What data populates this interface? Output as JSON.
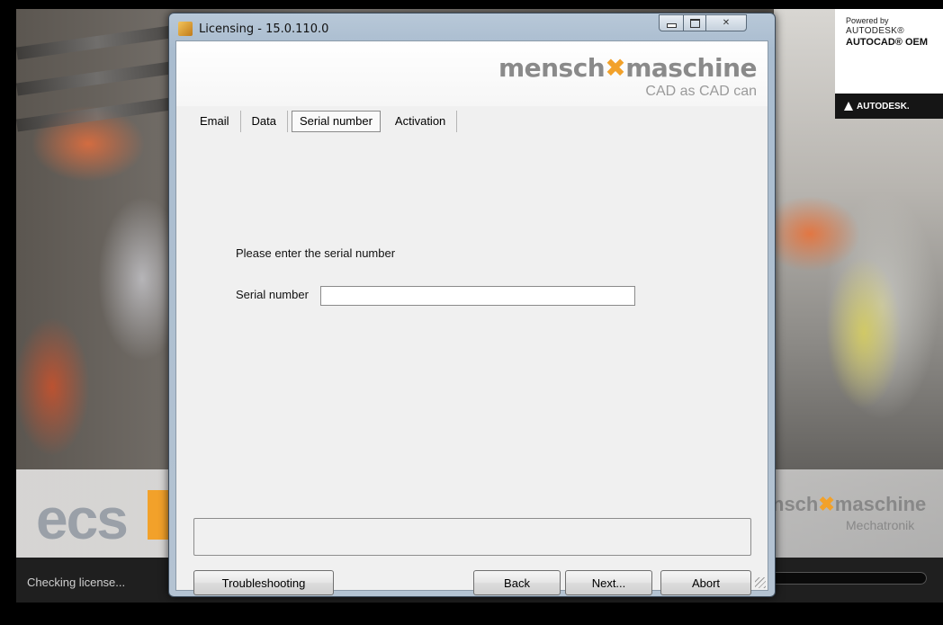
{
  "window": {
    "title": "Licensing - 15.0.110.0"
  },
  "header": {
    "logo_left": "mensch",
    "logo_mark": "✖",
    "logo_right": "maschine",
    "tagline": "CAD as CAD can"
  },
  "tabs": [
    {
      "label": "Email",
      "active": false
    },
    {
      "label": "Data",
      "active": false
    },
    {
      "label": "Serial number",
      "active": true
    },
    {
      "label": "Activation",
      "active": false
    }
  ],
  "form": {
    "prompt": "Please enter the serial number",
    "serial_label": "Serial number",
    "serial_value": ""
  },
  "buttons": {
    "troubleshooting": "Troubleshooting",
    "back": "Back",
    "next": "Next...",
    "abort": "Abort"
  },
  "splash": {
    "ecs_logo": "ecs",
    "powered_by": "Powered by",
    "autodesk": "AUTODESK®",
    "autocad_oem": "AUTOCAD® OEM",
    "autodesk_brand": "AUTODESK.",
    "right_logo_left": "nsch",
    "right_logo_mark": "✖",
    "right_logo_right": "maschine",
    "right_logo_sub": "Mechatronik",
    "status": "Checking license..."
  },
  "colors": {
    "accent_orange": "#f2a12a",
    "window_frame": "#b4c3d2",
    "client_bg": "#f0f0f0"
  }
}
